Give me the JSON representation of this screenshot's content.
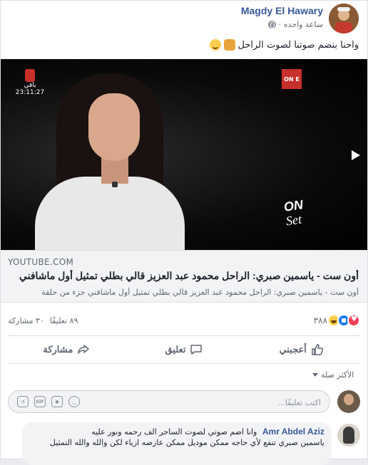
{
  "post": {
    "author": "Magdy El Hawary",
    "time": "ساعة واحده ·",
    "text": "واحنا بنضم صوتنا لصوت الراحل",
    "emojis": [
      "fist-emoji",
      "grin-emoji"
    ]
  },
  "video": {
    "channel_left_label": "باقي",
    "channel_left_time": "23:11:27",
    "channel_right_label": "ON E",
    "overlay_logo": "ON",
    "overlay_script": "Set"
  },
  "link_preview": {
    "domain": "YOUTUBE.COM",
    "title": "أون ست - ياسمين صبري: الراحل محمود عبد العزيز قالي بطلي تمثيل أول ماشافني",
    "description": "أون ست - ياسمين صبري: الراحل محمود عبد العزيز قالي بطلي تمثيل أول ماشافني جزء من حلقة"
  },
  "reactions": {
    "count": "٣٨٨",
    "comments": "٨٩ تعليقًا",
    "shares": "٣٠ مشاركة",
    "types": [
      "haha",
      "like",
      "love"
    ]
  },
  "actions": {
    "like": "أعجبني",
    "comment": "تعليق",
    "share": "مشاركة"
  },
  "sort": {
    "label": "الأكثر صلة"
  },
  "compose": {
    "placeholder": "اكتب تعليقًا..."
  },
  "comment": {
    "author": "Amr Abdel Aziz",
    "line1": "وانا اضم صوتي لصوت الساحر الف رحمه ونور عليه",
    "line2": "ياسمين صبري تنفع لأي حاجه ممكن موديل ممكن عارضه ازياء لكن والله والله التمثيل"
  }
}
